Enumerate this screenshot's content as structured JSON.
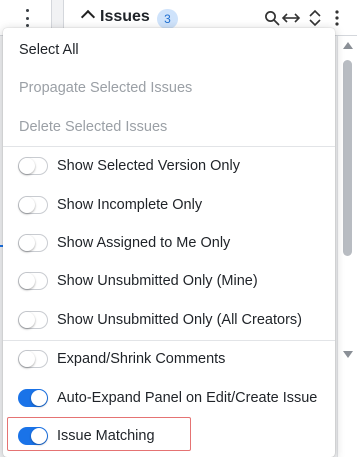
{
  "header": {
    "title": "Issues",
    "count": "3",
    "icons": [
      "search-icon",
      "expand-horizontal-icon",
      "sort-icon",
      "more-icon"
    ]
  },
  "menu": {
    "actions": [
      {
        "label": "Select All",
        "enabled": true
      },
      {
        "label": "Propagate Selected Issues",
        "enabled": false
      },
      {
        "label": "Delete Selected Issues",
        "enabled": false
      }
    ],
    "filters": [
      {
        "label": "Show Selected Version Only",
        "on": false
      },
      {
        "label": "Show Incomplete Only",
        "on": false
      },
      {
        "label": "Show Assigned to Me Only",
        "on": false
      },
      {
        "label": "Show Unsubmitted Only (Mine)",
        "on": false
      },
      {
        "label": "Show Unsubmitted Only (All Creators)",
        "on": false
      }
    ],
    "options": [
      {
        "label": "Expand/Shrink Comments",
        "on": false
      },
      {
        "label": "Auto-Expand Panel on Edit/Create Issue",
        "on": true
      },
      {
        "label": "Issue Matching",
        "on": true
      }
    ]
  },
  "colors": {
    "accent": "#1a73e8",
    "badge_bg": "#cfe3fb",
    "highlight": "#e57373"
  }
}
